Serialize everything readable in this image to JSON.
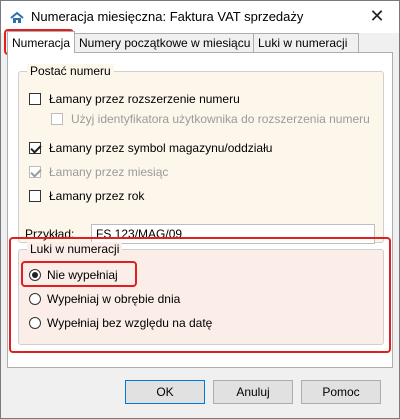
{
  "window": {
    "title": "Numeracja miesięczna: Faktura VAT sprzedaży",
    "close_glyph": "✕",
    "icon": "app-icon"
  },
  "tabs": [
    {
      "label": "Numeracja"
    },
    {
      "label": "Numery początkowe w miesiącu"
    },
    {
      "label": "Luki w numeracji"
    }
  ],
  "postac": {
    "legend": "Postać numeru",
    "options": [
      {
        "label": "Łamany przez rozszerzenie numeru",
        "checked": false,
        "disabled": false
      },
      {
        "label": "Użyj identyfikatora użytkownika do rozszerzenia numeru",
        "checked": false,
        "disabled": true
      },
      {
        "label": "Łamany przez symbol magazynu/oddziału",
        "checked": true,
        "disabled": false
      },
      {
        "label": "Łamany przez miesiąc",
        "checked": true,
        "disabled": true
      },
      {
        "label": "Łamany przez rok",
        "checked": false,
        "disabled": false
      }
    ],
    "example_label": "Przykład:",
    "example_value": "FS 123/MAG/09"
  },
  "luki": {
    "legend": "Luki w numeracji",
    "options": [
      {
        "label": "Nie wypełniaj",
        "selected": true
      },
      {
        "label": "Wypełniaj w obrębie dnia",
        "selected": false
      },
      {
        "label": "Wypełniaj bez względu na datę",
        "selected": false
      }
    ]
  },
  "buttons": {
    "ok": "OK",
    "cancel": "Anuluj",
    "help": "Pomoc"
  },
  "colors": {
    "highlight": "#e02020",
    "group_bg": "#fdf6ea",
    "luki_bg": "#fbeee8"
  }
}
